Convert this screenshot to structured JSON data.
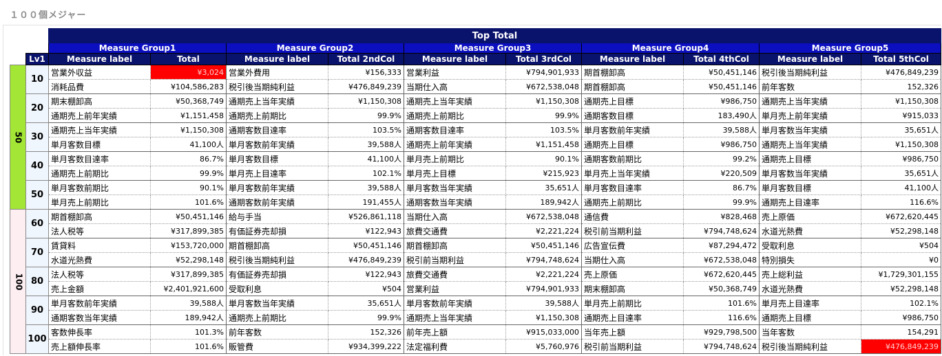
{
  "page_title": "１００個メジャー",
  "top_total": "Top Total",
  "lv1_header": "Lv1",
  "colors": {
    "header_dark": "#0a136b",
    "header_blue": "#0b0fbf",
    "group50": "#a3e635",
    "group100": "#fdeef2",
    "highlight": "#ff0000"
  },
  "groups": [
    {
      "name": "Measure Group1",
      "label_header": "Measure label",
      "value_header": "Total"
    },
    {
      "name": "Measure Group2",
      "label_header": "Measure label",
      "value_header": "Total 2ndCol"
    },
    {
      "name": "Measure Group3",
      "label_header": "Measure label",
      "value_header": "Total 3rdCol"
    },
    {
      "name": "Measure Group4",
      "label_header": "Measure label",
      "value_header": "Total 4thCol"
    },
    {
      "name": "Measure Group5",
      "label_header": "Measure label",
      "value_header": "Total 5thCol"
    }
  ],
  "lv0": [
    {
      "label": "50",
      "color": "#a3e635"
    },
    {
      "label": "100",
      "color": "#fdeef2"
    }
  ],
  "blocks": [
    {
      "lv0": 0,
      "lv1": "10",
      "rows": [
        [
          [
            "営業外収益",
            "¥3,024",
            1
          ],
          [
            "営業外費用",
            "¥156,333",
            0
          ],
          [
            "営業利益",
            "¥794,901,933",
            0
          ],
          [
            "期首棚卸高",
            "¥50,451,146",
            0
          ],
          [
            "税引後当期純利益",
            "¥476,849,239",
            0
          ]
        ],
        [
          [
            "消耗品費",
            "¥104,586,283",
            0
          ],
          [
            "税引後当期純利益",
            "¥476,849,239",
            0
          ],
          [
            "当期仕入高",
            "¥672,538,048",
            0
          ],
          [
            "期首棚卸高",
            "¥50,451,146",
            0
          ],
          [
            "前年客数",
            "152,326",
            0
          ]
        ]
      ]
    },
    {
      "lv0": 0,
      "lv1": "20",
      "rows": [
        [
          [
            "期末棚卸高",
            "¥50,368,749",
            0
          ],
          [
            "通期売上当年実績",
            "¥1,150,308",
            0
          ],
          [
            "通期売上当年実績",
            "¥1,150,308",
            0
          ],
          [
            "通期売上目標",
            "¥986,750",
            0
          ],
          [
            "通期売上当年実績",
            "¥1,150,308",
            0
          ]
        ],
        [
          [
            "通期売上前年実績",
            "¥1,151,458",
            0
          ],
          [
            "通期売上前期比",
            "99.9%",
            0
          ],
          [
            "通期売上前期比",
            "99.9%",
            0
          ],
          [
            "通期客数目標",
            "183,490人",
            0
          ],
          [
            "単月売上前年実績",
            "¥915,033",
            0
          ]
        ]
      ]
    },
    {
      "lv0": 0,
      "lv1": "30",
      "rows": [
        [
          [
            "通期売上当年実績",
            "¥1,150,308",
            0
          ],
          [
            "通期客数目達率",
            "103.5%",
            0
          ],
          [
            "通期客数目達率",
            "103.5%",
            0
          ],
          [
            "単月客数前年実績",
            "39,588人",
            0
          ],
          [
            "単月客数当年実績",
            "35,651人",
            0
          ]
        ],
        [
          [
            "単月客数目標",
            "41,100人",
            0
          ],
          [
            "単月客数前年実績",
            "39,588人",
            0
          ],
          [
            "通期売上前年実績",
            "¥1,151,458",
            0
          ],
          [
            "通期売上目標",
            "¥986,750",
            0
          ],
          [
            "通期売上当年実績",
            "¥1,150,308",
            0
          ]
        ]
      ]
    },
    {
      "lv0": 0,
      "lv1": "40",
      "rows": [
        [
          [
            "単月客数目達率",
            "86.7%",
            0
          ],
          [
            "単月客数目標",
            "41,100人",
            0
          ],
          [
            "単月売上前期比",
            "90.1%",
            0
          ],
          [
            "通期客数前期比",
            "99.2%",
            0
          ],
          [
            "通期売上目標",
            "¥986,750",
            0
          ]
        ],
        [
          [
            "通期売上前期比",
            "99.9%",
            0
          ],
          [
            "単月売上目達率",
            "102.1%",
            0
          ],
          [
            "単月売上目標",
            "¥215,923",
            0
          ],
          [
            "単月売上当年実績",
            "¥220,509",
            0
          ],
          [
            "単月客数当年実績",
            "35,651人",
            0
          ]
        ]
      ]
    },
    {
      "lv0": 0,
      "lv1": "50",
      "rows": [
        [
          [
            "単月客数前期比",
            "90.1%",
            0
          ],
          [
            "単月客数前年実績",
            "39,588人",
            0
          ],
          [
            "単月客数当年実績",
            "35,651人",
            0
          ],
          [
            "単月客数目達率",
            "86.7%",
            0
          ],
          [
            "単月客数目標",
            "41,100人",
            0
          ]
        ],
        [
          [
            "単月売上前期比",
            "101.6%",
            0
          ],
          [
            "通期客数前年実績",
            "191,455人",
            0
          ],
          [
            "通期客数当年実績",
            "189,942人",
            0
          ],
          [
            "通期売上前期比",
            "99.9%",
            0
          ],
          [
            "通期売上目達率",
            "116.6%",
            0
          ]
        ]
      ]
    },
    {
      "lv0": 1,
      "lv1": "60",
      "rows": [
        [
          [
            "期首棚卸高",
            "¥50,451,146",
            0
          ],
          [
            "給与手当",
            "¥526,861,118",
            0
          ],
          [
            "当期仕入高",
            "¥672,538,048",
            0
          ],
          [
            "通信費",
            "¥828,468",
            0
          ],
          [
            "売上原価",
            "¥672,620,445",
            0
          ]
        ],
        [
          [
            "法人税等",
            "¥317,899,385",
            0
          ],
          [
            "有価証券売却損",
            "¥122,943",
            0
          ],
          [
            "旅費交通費",
            "¥2,221,224",
            0
          ],
          [
            "税引前当期利益",
            "¥794,748,624",
            0
          ],
          [
            "水道光熱費",
            "¥52,298,148",
            0
          ]
        ]
      ]
    },
    {
      "lv0": 1,
      "lv1": "70",
      "rows": [
        [
          [
            "賃貸料",
            "¥153,720,000",
            0
          ],
          [
            "期首棚卸高",
            "¥50,451,146",
            0
          ],
          [
            "期首棚卸高",
            "¥50,451,146",
            0
          ],
          [
            "広告宣伝費",
            "¥87,294,472",
            0
          ],
          [
            "受取利息",
            "¥504",
            0
          ]
        ],
        [
          [
            "水道光熱費",
            "¥52,298,148",
            0
          ],
          [
            "税引後当期純利益",
            "¥476,849,239",
            0
          ],
          [
            "税引前当期利益",
            "¥794,748,624",
            0
          ],
          [
            "当期仕入高",
            "¥672,538,048",
            0
          ],
          [
            "特別損失",
            "¥0",
            0
          ]
        ]
      ]
    },
    {
      "lv0": 1,
      "lv1": "80",
      "rows": [
        [
          [
            "法人税等",
            "¥317,899,385",
            0
          ],
          [
            "有価証券売却損",
            "¥122,943",
            0
          ],
          [
            "旅費交通費",
            "¥2,221,224",
            0
          ],
          [
            "売上原価",
            "¥672,620,445",
            0
          ],
          [
            "売上総利益",
            "¥1,729,301,155",
            0
          ]
        ],
        [
          [
            "売上金額",
            "¥2,401,921,600",
            0
          ],
          [
            "受取利息",
            "¥504",
            0
          ],
          [
            "営業利益",
            "¥794,901,933",
            0
          ],
          [
            "期末棚卸高",
            "¥50,368,749",
            0
          ],
          [
            "水道光熱費",
            "¥52,298,148",
            0
          ]
        ]
      ]
    },
    {
      "lv0": 1,
      "lv1": "90",
      "rows": [
        [
          [
            "単月客数前年実績",
            "39,588人",
            0
          ],
          [
            "単月客数当年実績",
            "35,651人",
            0
          ],
          [
            "単月客数前年実績",
            "39,588人",
            0
          ],
          [
            "単月売上前期比",
            "101.6%",
            0
          ],
          [
            "単月売上目達率",
            "102.1%",
            0
          ]
        ],
        [
          [
            "通期客数当年実績",
            "189,942人",
            0
          ],
          [
            "通期売上前期比",
            "99.9%",
            0
          ],
          [
            "通期売上当年実績",
            "¥1,150,308",
            0
          ],
          [
            "通期売上目達率",
            "116.6%",
            0
          ],
          [
            "通期売上目標",
            "¥986,750",
            0
          ]
        ]
      ]
    },
    {
      "lv0": 1,
      "lv1": "100",
      "rows": [
        [
          [
            "客数伸長率",
            "101.3%",
            0
          ],
          [
            "前年客数",
            "152,326",
            0
          ],
          [
            "前年売上額",
            "¥915,033,000",
            0
          ],
          [
            "当年売上額",
            "¥929,798,500",
            0
          ],
          [
            "当年客数",
            "154,291",
            0
          ]
        ],
        [
          [
            "売上額伸長率",
            "101.6%",
            0
          ],
          [
            "販管費",
            "¥934,399,222",
            0
          ],
          [
            "法定福利費",
            "¥5,760,976",
            0
          ],
          [
            "税引前当期利益",
            "¥794,748,624",
            0
          ],
          [
            "税引後当期純利益",
            "¥476,849,239",
            1
          ]
        ]
      ]
    }
  ]
}
